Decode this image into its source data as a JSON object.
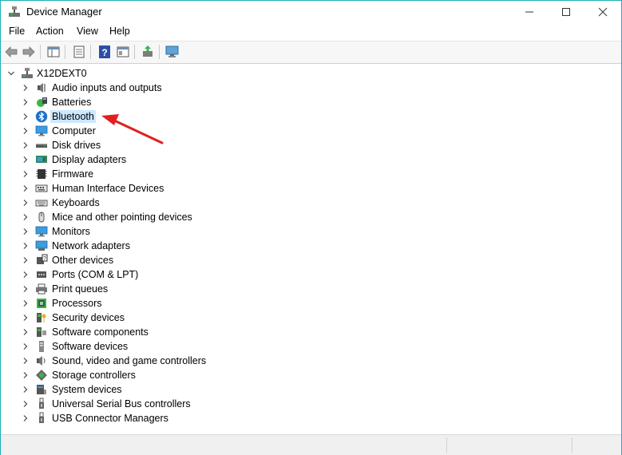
{
  "window": {
    "title": "Device Manager",
    "accent_color": "#1ab0b8"
  },
  "menubar": {
    "items": [
      {
        "label": "File"
      },
      {
        "label": "Action"
      },
      {
        "label": "View"
      },
      {
        "label": "Help"
      }
    ]
  },
  "toolbar": {
    "buttons": [
      {
        "icon": "back-arrow-icon"
      },
      {
        "icon": "forward-arrow-icon"
      },
      {
        "icon": "show-hide-console-tree-icon"
      },
      {
        "icon": "properties-icon"
      },
      {
        "icon": "help-icon"
      },
      {
        "icon": "console-view-icon"
      },
      {
        "icon": "update-driver-icon"
      },
      {
        "icon": "scan-hardware-changes-icon"
      }
    ]
  },
  "tree": {
    "root": {
      "label": "X12DEXT0",
      "icon": "computer-root-icon"
    },
    "selected_color": "#cce8ff",
    "items": [
      {
        "label": "Audio inputs and outputs",
        "icon": "speaker-icon"
      },
      {
        "label": "Batteries",
        "icon": "battery-icon"
      },
      {
        "label": "Bluetooth",
        "icon": "bluetooth-icon",
        "selected": true
      },
      {
        "label": "Computer",
        "icon": "monitor-icon"
      },
      {
        "label": "Disk drives",
        "icon": "disk-drive-icon"
      },
      {
        "label": "Display adapters",
        "icon": "display-adapter-icon"
      },
      {
        "label": "Firmware",
        "icon": "chip-icon"
      },
      {
        "label": "Human Interface Devices",
        "icon": "hid-icon"
      },
      {
        "label": "Keyboards",
        "icon": "keyboard-icon"
      },
      {
        "label": "Mice and other pointing devices",
        "icon": "mouse-icon"
      },
      {
        "label": "Monitors",
        "icon": "monitor-icon"
      },
      {
        "label": "Network adapters",
        "icon": "network-adapter-icon"
      },
      {
        "label": "Other devices",
        "icon": "unknown-device-icon"
      },
      {
        "label": "Ports (COM & LPT)",
        "icon": "port-icon"
      },
      {
        "label": "Print queues",
        "icon": "printer-icon"
      },
      {
        "label": "Processors",
        "icon": "processor-icon"
      },
      {
        "label": "Security devices",
        "icon": "security-key-icon"
      },
      {
        "label": "Software components",
        "icon": "software-component-icon"
      },
      {
        "label": "Software devices",
        "icon": "software-device-icon"
      },
      {
        "label": "Sound, video and game controllers",
        "icon": "sound-icon"
      },
      {
        "label": "Storage controllers",
        "icon": "storage-controller-icon"
      },
      {
        "label": "System devices",
        "icon": "system-device-icon"
      },
      {
        "label": "Universal Serial Bus controllers",
        "icon": "usb-icon"
      },
      {
        "label": "USB Connector Managers",
        "icon": "usb-icon"
      }
    ]
  },
  "annotation": {
    "icon": "red-arrow-icon",
    "color": "#e02020"
  }
}
